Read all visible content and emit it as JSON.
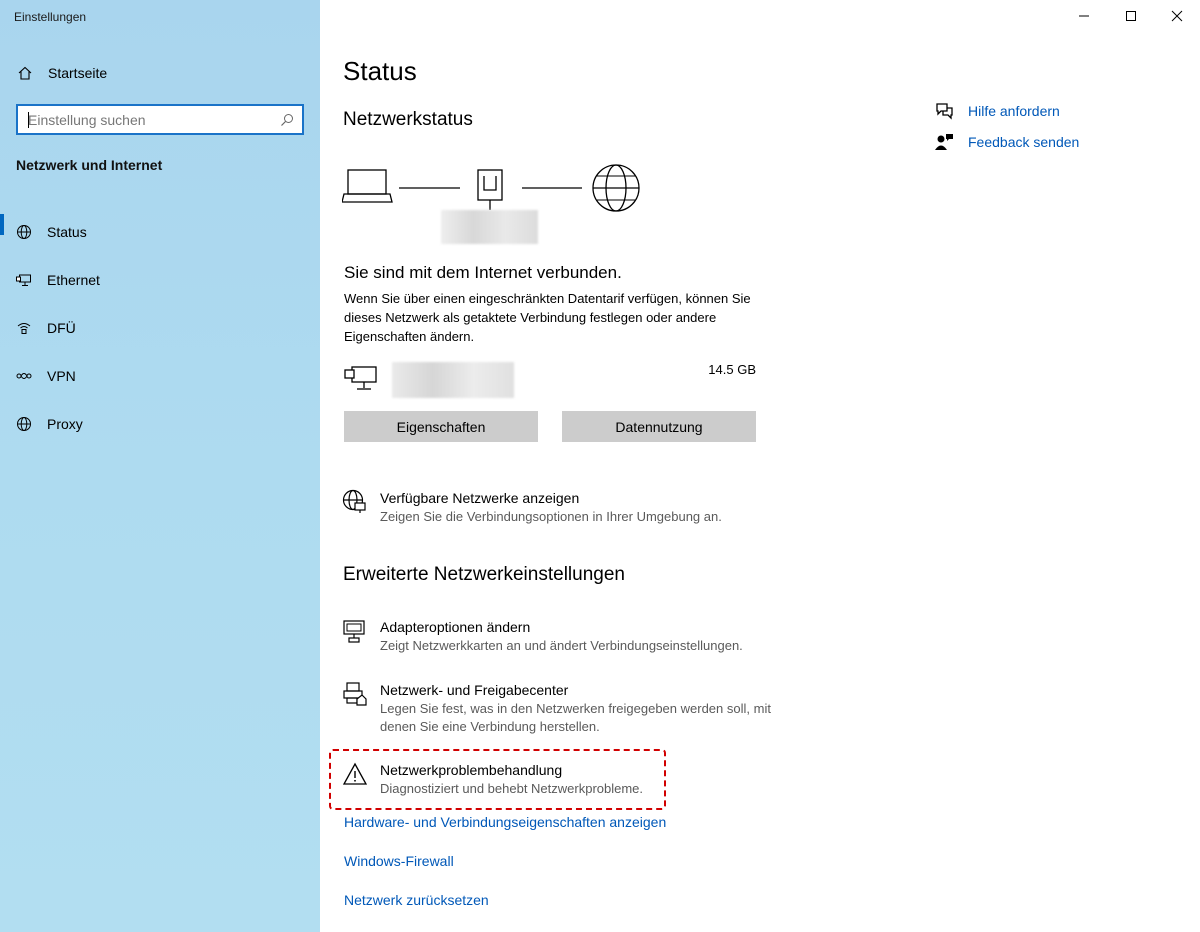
{
  "window": {
    "title": "Einstellungen",
    "controls": [
      "minimize",
      "maximize",
      "close"
    ]
  },
  "sidebar": {
    "home_label": "Startseite",
    "search_placeholder": "Einstellung suchen",
    "section_title": "Netzwerk und Internet",
    "items": [
      {
        "label": "Status",
        "icon": "globe-icon",
        "active": true
      },
      {
        "label": "Ethernet",
        "icon": "ethernet-icon",
        "active": false
      },
      {
        "label": "DFÜ",
        "icon": "dialup-icon",
        "active": false
      },
      {
        "label": "VPN",
        "icon": "vpn-icon",
        "active": false
      },
      {
        "label": "Proxy",
        "icon": "globe-icon",
        "active": false
      }
    ]
  },
  "main": {
    "title": "Status",
    "network_status_heading": "Netzwerkstatus",
    "connected_text": "Sie sind mit dem Internet verbunden.",
    "description": "Wenn Sie über einen eingeschränkten Datentarif verfügen, können Sie dieses Netzwerk als getaktete Verbindung festlegen oder andere Eigenschaften ändern.",
    "data_usage_amount": "14.5 GB",
    "buttons": {
      "properties": "Eigenschaften",
      "data_usage": "Datennutzung"
    },
    "available_networks": {
      "title": "Verfügbare Netzwerke anzeigen",
      "subtitle": "Zeigen Sie die Verbindungsoptionen in Ihrer Umgebung an."
    },
    "advanced_heading": "Erweiterte Netzwerkeinstellungen",
    "advanced_options": [
      {
        "title": "Adapteroptionen ändern",
        "subtitle": "Zeigt Netzwerkkarten an und ändert Verbindungseinstellungen."
      },
      {
        "title": "Netzwerk- und Freigabecenter",
        "subtitle": "Legen Sie fest, was in den Netzwerken freigegeben werden soll, mit denen Sie eine Verbindung herstellen."
      },
      {
        "title": "Netzwerkproblembehandlung",
        "subtitle": "Diagnostiziert und behebt Netzwerkprobleme."
      }
    ],
    "links": [
      "Hardware- und Verbindungseigenschaften anzeigen",
      "Windows-Firewall",
      "Netzwerk zurücksetzen"
    ]
  },
  "help": {
    "get_help": "Hilfe anfordern",
    "feedback": "Feedback senden"
  },
  "colors": {
    "accent": "#0067c0",
    "link": "#0058b8",
    "highlight_box": "#d10000",
    "button_bg": "#cccccc"
  }
}
